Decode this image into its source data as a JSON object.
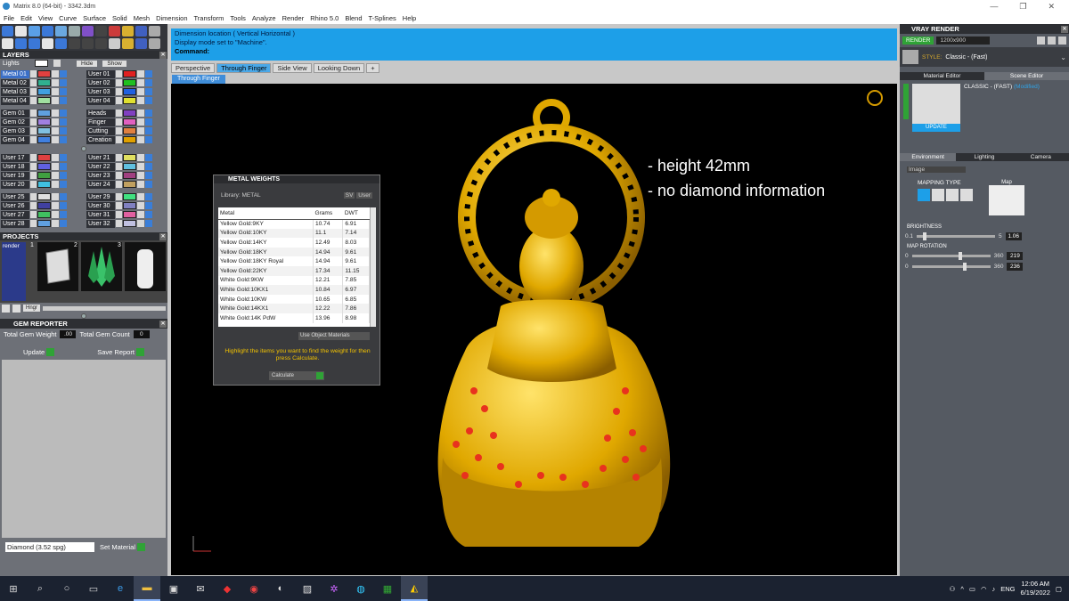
{
  "window": {
    "title": "Matrix 8.0 (64-bit) - 3342.3dm"
  },
  "menu": [
    "File",
    "Edit",
    "View",
    "Curve",
    "Surface",
    "Solid",
    "Mesh",
    "Dimension",
    "Transform",
    "Tools",
    "Analyze",
    "Render",
    "Rhino 5.0",
    "Blend",
    "T-Splines",
    "Help"
  ],
  "layers": {
    "title": "LAYERS",
    "lights": "Lights",
    "hide": "Hide",
    "show": "Show",
    "groups": [
      [
        [
          "Metal 01",
          "#e04040",
          "Metal 02",
          "#40c040"
        ],
        [
          "Metal 03",
          "#30b090",
          "User 01",
          "#e02020"
        ],
        [
          "Metal 03",
          "#40a0e0",
          "User 02",
          "#20c020"
        ],
        [
          "Metal 04",
          "#a0e0a0",
          "User 03",
          "#2060e0"
        ],
        [
          "Metal 04",
          "#60c0a0",
          "User 04",
          "#e0e030"
        ]
      ],
      [
        [
          "Gem 01",
          "#60a0e0",
          "Heads",
          "#8040c0"
        ],
        [
          "Gem 02",
          "#a080e0",
          "Finger",
          "#e060c0"
        ],
        [
          "Gem 03",
          "#80c0e0",
          "Cutting",
          "#e08040"
        ],
        [
          "Gem 04",
          "#4080e0",
          "Creation",
          "#e0a000"
        ]
      ],
      [
        [
          "User 17",
          "#e04040",
          "User 21",
          "#e0e060"
        ],
        [
          "User 18",
          "#6060e0",
          "User 22",
          "#60c0e0"
        ],
        [
          "User 19",
          "#40a040",
          "User 23",
          "#a04080"
        ],
        [
          "User 20",
          "#40c0e0",
          "User 24",
          "#c0a060"
        ]
      ],
      [
        [
          "User 25",
          "#e0e0e0",
          "User 29",
          "#40e080"
        ],
        [
          "User 26",
          "#4040a0",
          "User 30",
          "#8080c0"
        ],
        [
          "User 27",
          "#40c060",
          "User 31",
          "#e060a0"
        ],
        [
          "User 28",
          "#60a0e0",
          "User 32",
          "#c0c0e0"
        ]
      ]
    ],
    "rows_fixed": [
      [
        "Metal 01",
        "#e04040",
        "User 01",
        "#e02020"
      ],
      [
        "Metal 02",
        "#30b090",
        "User 02",
        "#20c020"
      ],
      [
        "Metal 03",
        "#40a0e0",
        "User 03",
        "#2060e0"
      ],
      [
        "Metal 04",
        "#a0e0a0",
        "User 04",
        "#e0e030"
      ]
    ]
  },
  "projects": {
    "title": "PROJECTS",
    "item": "render",
    "thumbs": [
      "1",
      "2",
      "3"
    ],
    "hinge": "Hngr"
  },
  "gem_reporter": {
    "title": "GEM REPORTER",
    "total_gem_weight_label": "Total Gem Weight",
    "total_gem_weight": ".00",
    "total_gem_count_label": "Total Gem Count",
    "total_gem_count": "0",
    "update": "Update",
    "save_report": "Save Report"
  },
  "diamond": {
    "selected": "Diamond    (3.52 spg)",
    "set_material": "Set Material"
  },
  "command": {
    "line1": "Dimension location ( Vertical  Horizontal )",
    "line2": "Display mode set to \"Machine\".",
    "prompt": "Command:"
  },
  "viewport_tabs": [
    "Perspective",
    "Through Finger",
    "Side View",
    "Looking Down",
    "+"
  ],
  "active_tab_index": 1,
  "sub_tab": "Through Finger",
  "annotation": [
    "- height 42mm",
    "- no diamond information"
  ],
  "metal_weights": {
    "title": "METAL WEIGHTS",
    "library": "Library: METAL",
    "sv": "SV",
    "user": "User",
    "headers": [
      "Metal",
      "Grams",
      "DWT"
    ],
    "rows": [
      [
        "Yellow Gold:9KY",
        "10.74",
        "6.91"
      ],
      [
        "Yellow Gold:10KY",
        "11.1",
        "7.14"
      ],
      [
        "Yellow Gold:14KY",
        "12.49",
        "8.03"
      ],
      [
        "Yellow Gold:18KY",
        "14.94",
        "9.61"
      ],
      [
        "Yellow Gold:18KY Royal",
        "14.94",
        "9.61"
      ],
      [
        "Yellow Gold:22KY",
        "17.34",
        "11.15"
      ],
      [
        "White Gold:9KW",
        "12.21",
        "7.85"
      ],
      [
        "White Gold:10KX1",
        "10.84",
        "6.97"
      ],
      [
        "White Gold:10KW",
        "10.65",
        "6.85"
      ],
      [
        "White Gold:14KX1",
        "12.22",
        "7.86"
      ],
      [
        "White Gold:14K PdW",
        "13.96",
        "8.98"
      ]
    ],
    "use_object": "Use Object Materials",
    "hint": "Highlight the items you want to find the weight for then press Calculate.",
    "calculate": "Calculate"
  },
  "vray": {
    "title": "VRAY RENDER",
    "render": "RENDER",
    "resolution": "1200x900",
    "style_label": "STYLE:",
    "style": "Classic - (Fast)",
    "tabs": [
      "Material Editor",
      "Scene Editor"
    ],
    "preset": "CLASSIC - (FAST)",
    "modified": "(Modified)",
    "update": "UPDATE",
    "env_tabs": [
      "Environment",
      "Lighting",
      "Camera"
    ],
    "env_type": "Image",
    "mapping_type": "MAPPING TYPE",
    "map": "Map",
    "brightness": "BRIGHTNESS",
    "bmin": "0.1",
    "bmax": "5",
    "bval": "1.06",
    "map_rotation": "MAP ROTATION",
    "r1min": "0",
    "r1max": "360",
    "r1val": "219",
    "r2min": "0",
    "r2max": "360",
    "r2val": "236"
  },
  "tray": {
    "lang": "ENG",
    "time": "12:06 AM",
    "date": "6/19/2022"
  }
}
